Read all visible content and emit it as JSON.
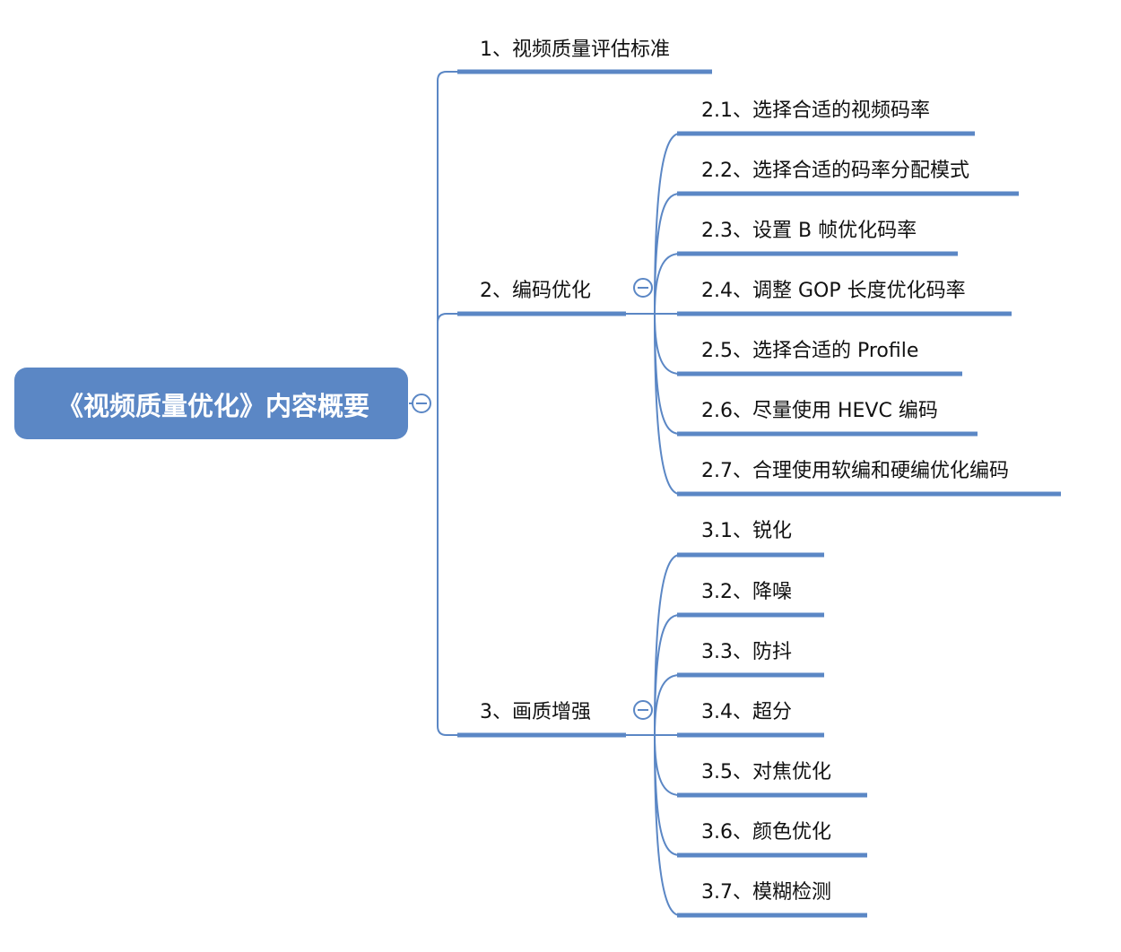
{
  "colors": {
    "accent": "#5b87c5",
    "root_fill": "#5b87c5",
    "root_text": "#ffffff",
    "text": "#111111",
    "background": "#ffffff"
  },
  "icons": {
    "collapse": "collapse-minus-icon"
  },
  "root": {
    "label": "《视频质量优化》内容概要"
  },
  "branches": [
    {
      "label": "1、视频质量评估标准",
      "children": []
    },
    {
      "label": "2、编码优化",
      "children": [
        "2.1、选择合适的视频码率",
        "2.2、选择合适的码率分配模式",
        "2.3、设置 B 帧优化码率",
        "2.4、调整 GOP 长度优化码率",
        "2.5、选择合适的 Profile",
        "2.6、尽量使用 HEVC 编码",
        "2.7、合理使用软编和硬编优化编码"
      ]
    },
    {
      "label": "3、画质增强",
      "children": [
        "3.1、锐化",
        "3.2、降噪",
        "3.3、防抖",
        "3.4、超分",
        "3.5、对焦优化",
        "3.6、颜色优化",
        "3.7、模糊检测"
      ]
    }
  ]
}
